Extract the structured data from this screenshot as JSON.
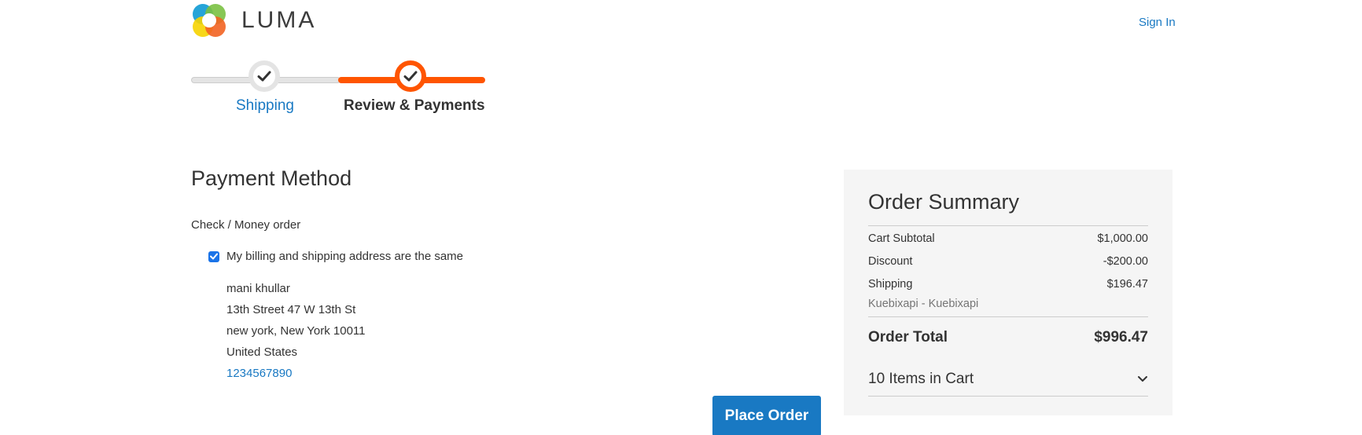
{
  "header": {
    "logo_text": "LUMA",
    "sign_in_label": "Sign In"
  },
  "progress": {
    "steps": [
      {
        "label": "Shipping",
        "status": "completed"
      },
      {
        "label": "Review & Payments",
        "status": "active"
      }
    ],
    "colors": {
      "active": "#ff5501",
      "inactive": "#e4e4e4",
      "link": "#1979c3"
    }
  },
  "payment": {
    "title": "Payment Method",
    "method_label": "Check / Money order",
    "same_address_label": "My billing and shipping address are the same",
    "same_address_checked": true,
    "address": {
      "name": "mani khullar",
      "street": "13th Street 47 W 13th St",
      "city_line": "new york, New York 10011",
      "country": "United States",
      "phone": "1234567890"
    },
    "place_order_label": "Place Order"
  },
  "summary": {
    "title": "Order Summary",
    "cart_subtotal_label": "Cart Subtotal",
    "cart_subtotal_value": "$1,000.00",
    "discount_label": "Discount",
    "discount_value": "-$200.00",
    "shipping_label": "Shipping",
    "shipping_value": "$196.47",
    "shipping_method": "Kuebixapi - Kuebixapi",
    "order_total_label": "Order Total",
    "order_total_value": "$996.47",
    "items_in_cart_label": "10 Items in Cart"
  },
  "icons": {
    "logo": "luma-logo-icon",
    "check": "checkmark-icon",
    "expand": "chevron-down-icon"
  },
  "colors": {
    "primary": "#1979c3",
    "accent": "#ff5501",
    "summary_bg": "#f5f5f5"
  }
}
